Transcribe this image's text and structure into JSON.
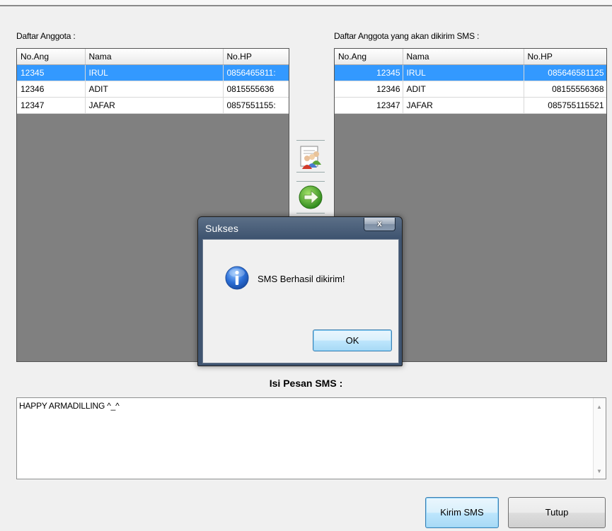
{
  "left_panel": {
    "label": "Daftar Anggota :",
    "columns": [
      "No.Ang",
      "Nama",
      "No.HP"
    ],
    "rows": [
      [
        "12345",
        "IRUL",
        "0856465811:"
      ],
      [
        "12346",
        "ADIT",
        "0815555636"
      ],
      [
        "12347",
        "JAFAR",
        "0857551155:"
      ]
    ],
    "selected_row": 0
  },
  "right_panel": {
    "label": "Daftar Anggota yang akan dikirim SMS :",
    "columns": [
      "No.Ang",
      "Nama",
      "No.HP"
    ],
    "rows": [
      [
        "12345",
        "IRUL",
        "085646581125"
      ],
      [
        "12346",
        "ADIT",
        "08155556368"
      ],
      [
        "12347",
        "JAFAR",
        "085755115521"
      ]
    ],
    "selected_row": 0
  },
  "toolbar": {
    "add_members_icon": "members-group-icon",
    "send_arrow_icon": "green-arrow-right-icon"
  },
  "message": {
    "title": "Isi Pesan SMS :",
    "value": "HAPPY ARMADILLING ^_^"
  },
  "buttons": {
    "send": "Kirim SMS",
    "close": "Tutup"
  },
  "dialog": {
    "title": "Sukses",
    "close_glyph": "x",
    "message": "SMS Berhasil dikirim!",
    "ok": "OK",
    "icon": "info-icon"
  },
  "colors": {
    "selection": "#3399ff",
    "grid_background": "#808080",
    "dialog_frame": "#3f5470"
  }
}
